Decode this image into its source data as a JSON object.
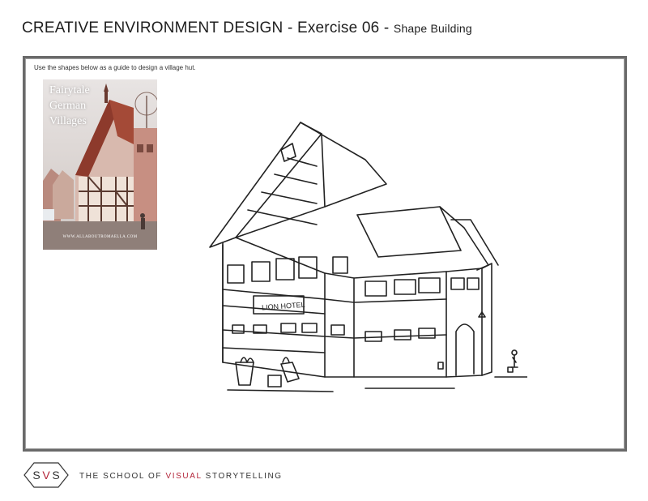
{
  "header": {
    "title": "CREATIVE ENVIRONMENT DESIGN - Exercise 06 - ",
    "subtitle": "Shape Building"
  },
  "exercise": {
    "instruction": "Use the shapes below as a guide to design a village hut.",
    "reference": {
      "title": "Fairytale\nGerman\nVillages",
      "url": "WWW.ALLABOUTROMAELLA.COM"
    },
    "sketch": {
      "sign_text": "LION HOTEL"
    }
  },
  "footer": {
    "logo_letters": [
      "S",
      "V",
      "S"
    ],
    "text_before": "THE SCHOOL OF ",
    "text_accent": "VISUAL",
    "text_after": " STORYTELLING",
    "accent_color": "#b3263a"
  }
}
